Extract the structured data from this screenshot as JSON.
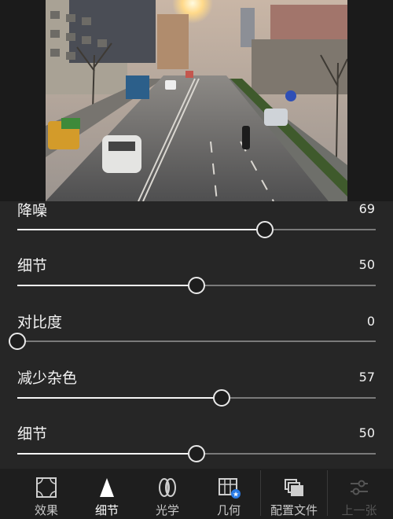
{
  "sliders": [
    {
      "label": "降噪",
      "value": "69",
      "level": 69,
      "min": 0,
      "max": 100
    },
    {
      "label": "细节",
      "value": "50",
      "level": 50,
      "min": 0,
      "max": 100
    },
    {
      "label": "对比度",
      "value": "0",
      "level": 0,
      "min": 0,
      "max": 100
    },
    {
      "label": "减少杂色",
      "value": "57",
      "level": 57,
      "min": 0,
      "max": 100
    },
    {
      "label": "细节",
      "value": "50",
      "level": 50,
      "min": 0,
      "max": 100
    }
  ],
  "tabs": [
    {
      "label": "效果",
      "icon": "effects-icon",
      "active": false,
      "disabled": false
    },
    {
      "label": "细节",
      "icon": "detail-triangle-icon",
      "active": true,
      "disabled": false
    },
    {
      "label": "光学",
      "icon": "optics-lens-icon",
      "active": false,
      "disabled": false
    },
    {
      "label": "几何",
      "icon": "geometry-grid-icon",
      "active": false,
      "disabled": false
    },
    {
      "label": "配置文件",
      "icon": "profile-stack-icon",
      "active": false,
      "disabled": false
    },
    {
      "label": "上一张",
      "icon": "previous-settings-icon",
      "active": false,
      "disabled": true
    }
  ],
  "colors": {
    "panel": "#262626",
    "background": "#1b1b1b",
    "track": "#7a7a7a",
    "fill": "#f5f5f5"
  }
}
